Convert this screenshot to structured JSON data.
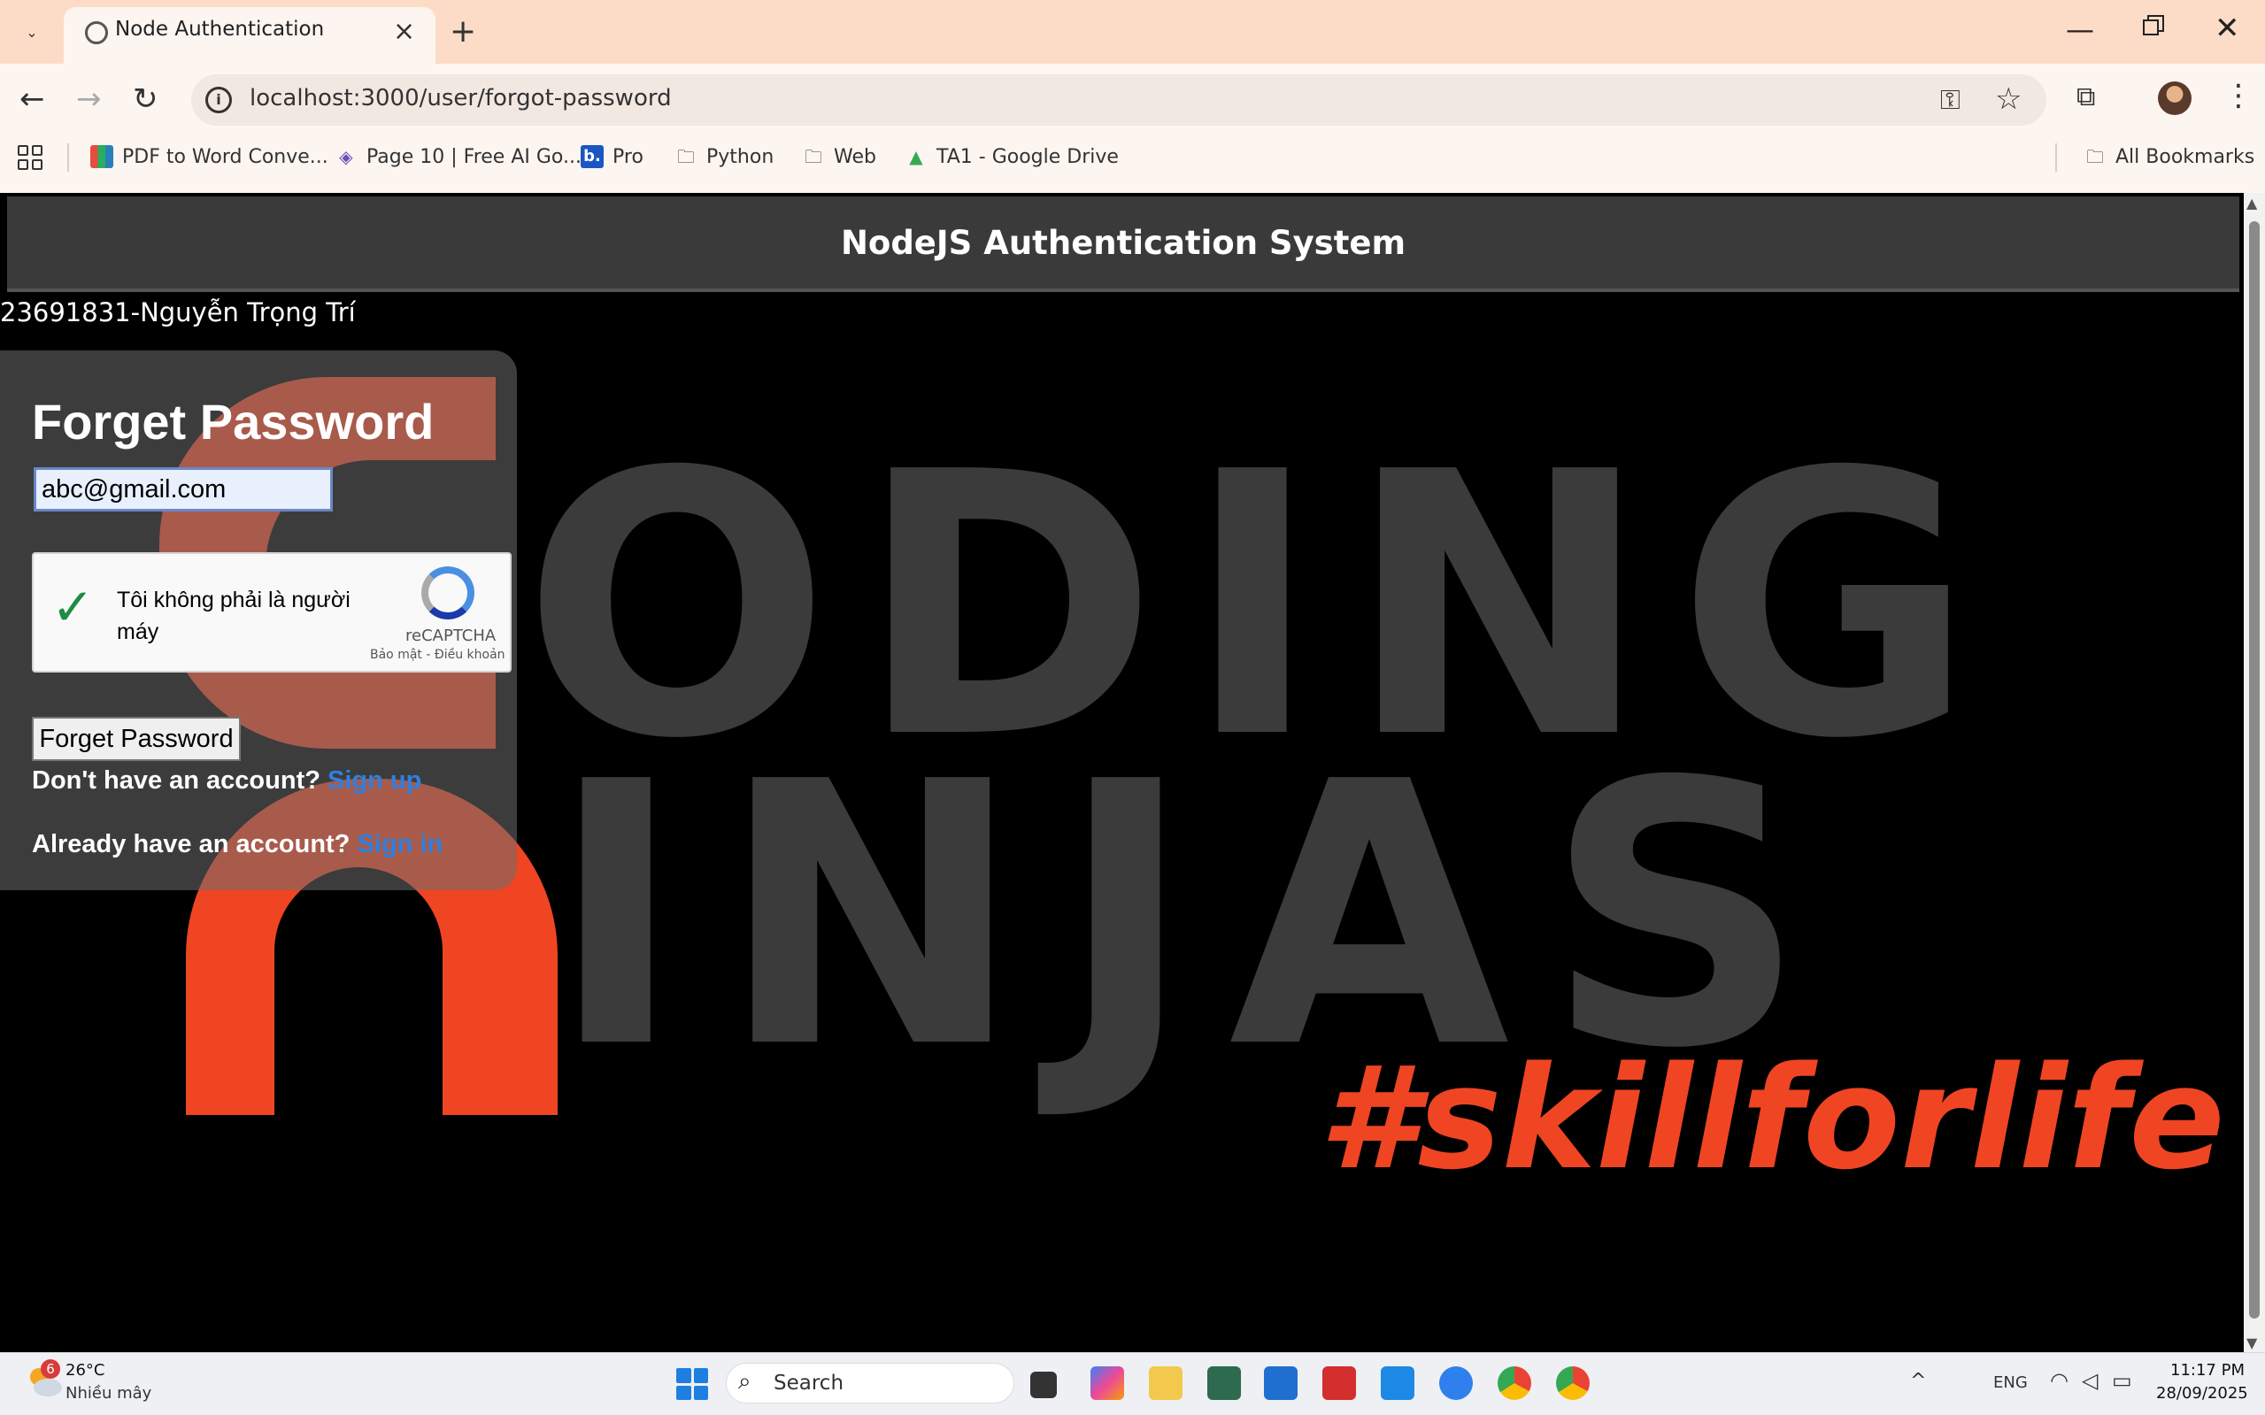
{
  "browser": {
    "tab_title": "Node Authentication",
    "url": "localhost:3000/user/forgot-password",
    "bookmarks": [
      {
        "label": "PDF to Word Conve...",
        "icon": "pdf-word-icon"
      },
      {
        "label": "Page 10 | Free AI Go...",
        "icon": "layers-icon"
      },
      {
        "label": "Pro",
        "icon": "b-icon"
      },
      {
        "label": "Python",
        "icon": "folder-icon"
      },
      {
        "label": "Web",
        "icon": "folder-icon"
      },
      {
        "label": "TA1 - Google Drive",
        "icon": "drive-icon"
      }
    ],
    "all_bookmarks": "All Bookmarks"
  },
  "page": {
    "header_title": "NodeJS Authentication System",
    "student": "23691831-Nguyễn Trọng Trí",
    "background_tagline": "#skillforlife",
    "form": {
      "title": "Forget Password",
      "email_value": "abc@gmail.com",
      "captcha_label": "Tôi không phải là người máy",
      "captcha_brand": "reCAPTCHA",
      "captcha_links": "Bảo mật - Điều khoản",
      "submit_label": "Forget Password",
      "signup_prompt": "Don't have an account?",
      "signup_link": "Sign up",
      "signin_prompt": "Already have an account?",
      "signin_link": "Sign in"
    }
  },
  "taskbar": {
    "weather_badge": "6",
    "temperature": "26°C",
    "weather_desc": "Nhiều mây",
    "search_placeholder": "Search",
    "language": "ENG",
    "time": "11:17 PM",
    "date": "28/09/2025"
  },
  "colors": {
    "accent_orange": "#ef4523",
    "link_blue": "#2f7fe0",
    "header_bg": "#3a3a3a"
  }
}
